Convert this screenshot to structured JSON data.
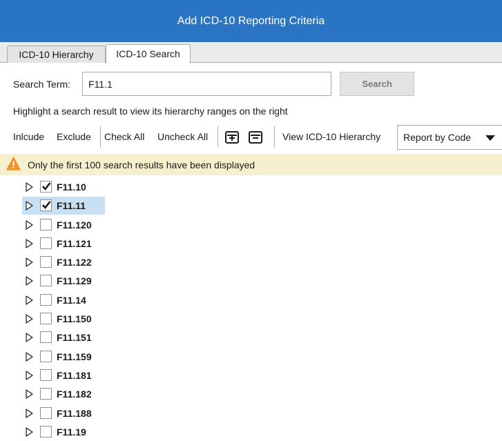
{
  "dialog": {
    "title": "Add ICD-10 Reporting Criteria"
  },
  "tabs": [
    {
      "label": "ICD-10 Hierarchy",
      "active": false
    },
    {
      "label": "ICD-10 Search",
      "active": true
    }
  ],
  "search": {
    "label": "Search Term:",
    "value": "F11.1",
    "button_label": "Search"
  },
  "hint": "Highlight a search result to view its hierarchy ranges on the right",
  "toolbar": {
    "include_label": "Inlcude",
    "exclude_label": "Exclude",
    "check_all_label": "Check All",
    "uncheck_all_label": "Uncheck All",
    "expand_icon": "expand-all-icon",
    "collapse_icon": "collapse-all-icon",
    "view_hierarchy_label": "View ICD-10 Hierarchy",
    "report_by": {
      "selected": "Report by Code"
    }
  },
  "notice": {
    "icon": "warning-icon",
    "text": "Only the first 100 search results have been displayed"
  },
  "colors": {
    "title_bar": "#2a74c4",
    "notice_bg": "#f7f0cf",
    "warning": "#f0922b",
    "selection": "#c9dff3"
  },
  "results": [
    {
      "code": "F11.10",
      "checked": true,
      "selected": false
    },
    {
      "code": "F11.11",
      "checked": true,
      "selected": true
    },
    {
      "code": "F11.120",
      "checked": false,
      "selected": false
    },
    {
      "code": "F11.121",
      "checked": false,
      "selected": false
    },
    {
      "code": "F11.122",
      "checked": false,
      "selected": false
    },
    {
      "code": "F11.129",
      "checked": false,
      "selected": false
    },
    {
      "code": "F11.14",
      "checked": false,
      "selected": false
    },
    {
      "code": "F11.150",
      "checked": false,
      "selected": false
    },
    {
      "code": "F11.151",
      "checked": false,
      "selected": false
    },
    {
      "code": "F11.159",
      "checked": false,
      "selected": false
    },
    {
      "code": "F11.181",
      "checked": false,
      "selected": false
    },
    {
      "code": "F11.182",
      "checked": false,
      "selected": false
    },
    {
      "code": "F11.188",
      "checked": false,
      "selected": false
    },
    {
      "code": "F11.19",
      "checked": false,
      "selected": false
    }
  ]
}
